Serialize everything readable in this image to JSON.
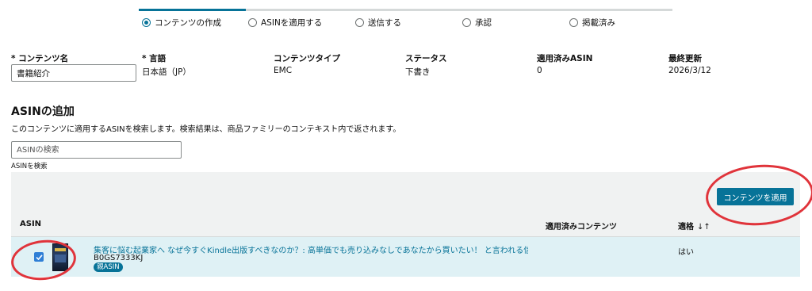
{
  "stepper": {
    "steps": [
      {
        "label": "コンテンツの作成",
        "selected": true
      },
      {
        "label": "ASINを適用する",
        "selected": false
      },
      {
        "label": "送信する",
        "selected": false
      },
      {
        "label": "承認",
        "selected": false
      },
      {
        "label": "掲載済み",
        "selected": false
      }
    ],
    "progress_fraction": 0.2,
    "accent_color": "#077398"
  },
  "content_info": {
    "name_label": "* コンテンツ名",
    "name_value": "書籍紹介",
    "language_label": "* 言語",
    "language_value": "日本語（JP）",
    "type_label": "コンテンツタイプ",
    "type_value": "EMC",
    "status_label": "ステータス",
    "status_value": "下書き",
    "applied_asin_label": "適用済みASIN",
    "applied_asin_value": "0",
    "last_updated_label": "最終更新",
    "last_updated_value": "2026/3/12"
  },
  "asin_section": {
    "title": "ASINの追加",
    "description": "このコンテンツに適用するASINを検索します。検索結果は、商品ファミリーのコンテキスト内で返されます。",
    "search_placeholder": "ASINの検索",
    "search_help": "ASINを検索"
  },
  "table": {
    "apply_button_label": "コンテンツを適用",
    "columns": {
      "asin": "ASIN",
      "applied_content": "適用済みコンテンツ",
      "eligibility": "適格"
    },
    "sort_icon": "sort-arrows-icon",
    "rows": [
      {
        "checked": true,
        "title": "集客に悩む起業家へ なぜ今すぐKindle出版すべきなのか？: 高単価でも売り込みなしであなたから買いたい！ と言われる信頼の作",
        "asin": "B0GS7333KJ",
        "badge": "親ASIN",
        "applied_content": "",
        "eligibility": "はい"
      }
    ]
  },
  "colors": {
    "accent": "#077398",
    "panel_background": "#f0f2f2",
    "selected_row": "#dff1f5",
    "checkbox": "#2f7fd6",
    "annotation": "#e0343b"
  }
}
